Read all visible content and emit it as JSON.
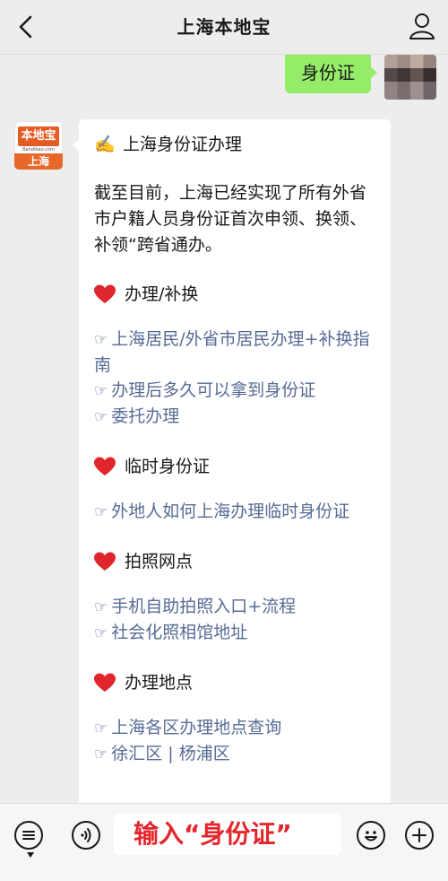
{
  "header": {
    "title": "上海本地宝"
  },
  "chat": {
    "user_message": "身份证",
    "bot_avatar": {
      "brand": "本地宝",
      "domain": "Bendibao.com",
      "city": "上海"
    },
    "reply": {
      "heading_emoji": "✍️",
      "heading": "上海身份证办理",
      "intro": "截至目前，上海已经实现了所有外省市户籍人员身份证首次申领、换领、补领“跨省通办。",
      "link_bullet": "☞",
      "sections": [
        {
          "title": "办理/补换",
          "links": [
            "上海居民/外省市居民办理+补换指南",
            "办理后多久可以拿到身份证",
            "委托办理"
          ]
        },
        {
          "title": "临时身份证",
          "links": [
            "外地人如何上海办理临时身份证"
          ]
        },
        {
          "title": "拍照网点",
          "links": [
            "手机自助拍照入口+流程",
            "社会化照相馆地址"
          ]
        },
        {
          "title": "办理地点",
          "links": [
            "上海各区办理地点查询",
            "徐汇区 | 杨浦区"
          ]
        }
      ]
    }
  },
  "input_bar": {
    "text": "输入“身份证”"
  },
  "colors": {
    "accent_green": "#95ec69",
    "link_blue": "#576b95",
    "heart_red": "#e0262c",
    "input_text_red": "#e4262c",
    "logo_orange": "#e55c22"
  },
  "icons": [
    "back-arrow-icon",
    "profile-icon",
    "heart-icon",
    "voice-keyboard-icon",
    "voice-icon",
    "emoji-icon",
    "add-icon"
  ]
}
